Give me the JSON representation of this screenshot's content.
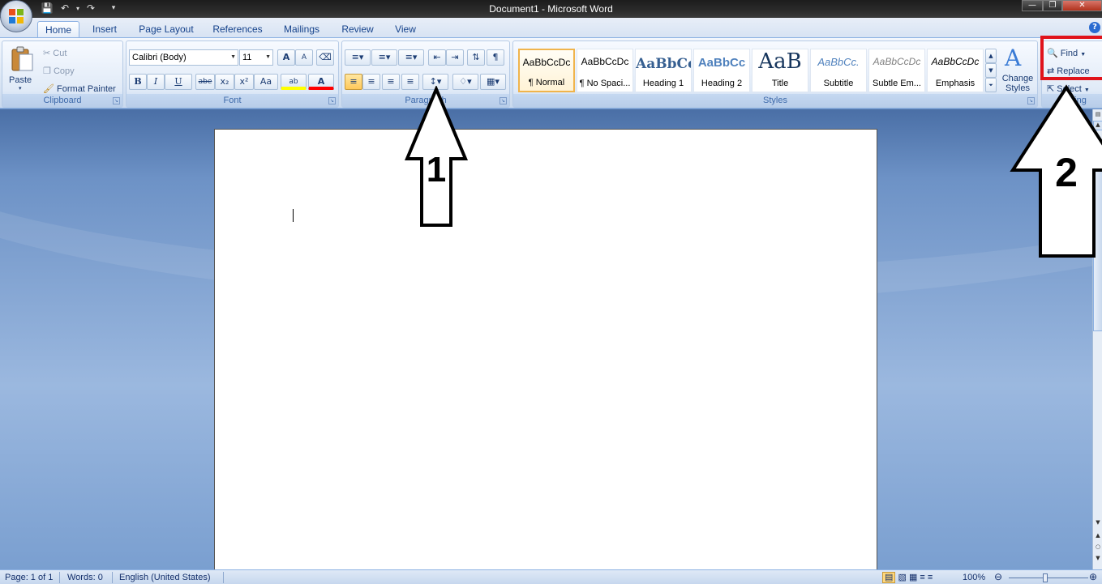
{
  "window": {
    "title": "Document1 - Microsoft Word"
  },
  "tabs": [
    "Home",
    "Insert",
    "Page Layout",
    "References",
    "Mailings",
    "Review",
    "View"
  ],
  "help": "?",
  "clipboard": {
    "paste": "Paste",
    "cut": "Cut",
    "copy": "Copy",
    "format_painter": "Format Painter",
    "label": "Clipboard"
  },
  "font": {
    "family": "Calibri (Body)",
    "size": "11",
    "label": "Font",
    "bold": "B",
    "italic": "I",
    "underline": "U",
    "strike": "abe",
    "sub": "x₂",
    "sup": "x²",
    "case": "Aa",
    "grow": "A",
    "shrink": "A",
    "highlight": "ab",
    "color": "A"
  },
  "paragraph": {
    "label": "Paragraph"
  },
  "styles": {
    "label": "Styles",
    "items": [
      {
        "sample": "AaBbCcDc",
        "name": "¶ Normal"
      },
      {
        "sample": "AaBbCcDc",
        "name": "¶ No Spaci..."
      },
      {
        "sample": "AaBbCc",
        "name": "Heading 1"
      },
      {
        "sample": "AaBbCc",
        "name": "Heading 2"
      },
      {
        "sample": "AaB",
        "name": "Title"
      },
      {
        "sample": "AaBbCc.",
        "name": "Subtitle"
      },
      {
        "sample": "AaBbCcDc",
        "name": "Subtle Em..."
      },
      {
        "sample": "AaBbCcDc",
        "name": "Emphasis"
      }
    ],
    "change": "Change Styles"
  },
  "editing": {
    "find": "Find",
    "replace": "Replace",
    "select": "Select",
    "label": "Editing"
  },
  "annotations": {
    "arrow1": "1",
    "arrow2": "2"
  },
  "status": {
    "page": "Page: 1 of 1",
    "words": "Words: 0",
    "language": "English (United States)",
    "zoom": "100%"
  },
  "colors": {
    "accent": "#15428b",
    "annotation_red": "#e0131b",
    "highlight": "#ffff00",
    "font_color": "#ff0000"
  }
}
